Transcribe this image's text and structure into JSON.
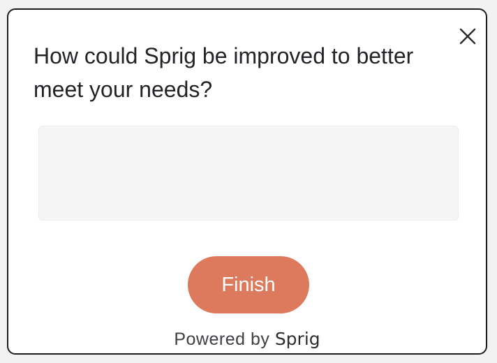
{
  "survey": {
    "question": "How could Sprig be improved to better meet your needs?",
    "answer_value": "",
    "finish_label": "Finish",
    "powered_by_prefix": "Powered by",
    "powered_by_brand": "Sprig",
    "close_icon": "close-icon"
  },
  "colors": {
    "accent": "#dd7a5e",
    "text": "#222327",
    "input_background": "#f5f5f5",
    "border": "#1c1c1e"
  }
}
